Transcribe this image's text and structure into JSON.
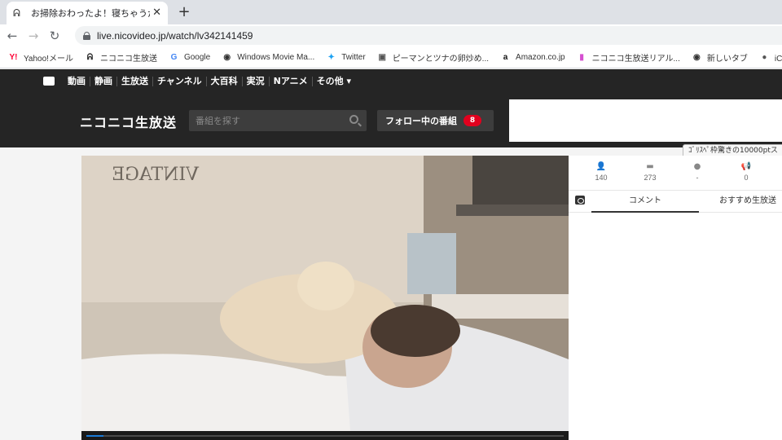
{
  "browser": {
    "tab": {
      "title": "お掃除おわったよ！寝ちゃうかもzzz",
      "favicon": "niconico-live-icon"
    },
    "url": "live.nicovideo.jp/watch/lv342141459",
    "bookmarks": [
      {
        "label": "Yahoo!メール",
        "icon": "yahoo-icon",
        "color": "#ff0033"
      },
      {
        "label": "ニコニコ生放送",
        "icon": "niconico-live-icon",
        "color": "#333333"
      },
      {
        "label": "Google",
        "icon": "google-icon",
        "color": "#4285f4"
      },
      {
        "label": "Windows Movie Ma...",
        "icon": "globe-icon",
        "color": "#333333"
      },
      {
        "label": "Twitter",
        "icon": "twitter-icon",
        "color": "#1da1f2"
      },
      {
        "label": "ピーマンとツナの卵炒め...",
        "icon": "recipe-icon",
        "color": "#555555"
      },
      {
        "label": "Amazon.co.jp",
        "icon": "amazon-icon",
        "color": "#111111"
      },
      {
        "label": "ニコニコ生放送リアル...",
        "icon": "niconico-pink-icon",
        "color": "#d54fd0"
      },
      {
        "label": "新しいタブ",
        "icon": "globe-icon",
        "color": "#333333"
      },
      {
        "label": "iCloud写真",
        "icon": "apple-icon",
        "color": "#555555"
      }
    ]
  },
  "site": {
    "nav": [
      "動画",
      "静画",
      "生放送",
      "チャンネル",
      "大百科",
      "実況",
      "Nアニメ",
      "その他 ▾"
    ],
    "logo": "ニコニコ生放送",
    "search_placeholder": "番組を探す",
    "follow_label": "フォロー中の番組",
    "follow_count": "8"
  },
  "player": {
    "progress": 0.035
  },
  "tooltip": "ｺﾞﾘｽﾍﾟ枠驚きの10000ptス",
  "stats": [
    {
      "icon": "viewer-icon",
      "glyph": "👤",
      "value": "140"
    },
    {
      "icon": "comment-icon",
      "glyph": "▬",
      "value": "273"
    },
    {
      "icon": "gift-icon",
      "glyph": "●",
      "value": "-"
    },
    {
      "icon": "ad-icon",
      "glyph": "📢",
      "value": "0"
    }
  ],
  "side_tabs": {
    "comment": "コメント",
    "recommend": "おすすめ生放送"
  },
  "colors": {
    "header": "#252525",
    "badge": "#e2001e",
    "progress": "#1b7bd6"
  }
}
